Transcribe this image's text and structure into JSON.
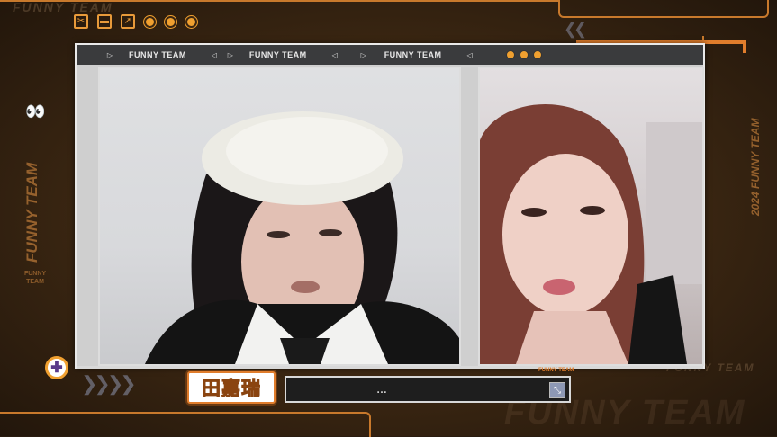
{
  "titlebar": {
    "labels": [
      "FUNNY TEAM",
      "FUNNY TEAM",
      "FUNNY TEAM"
    ]
  },
  "side_left": {
    "vertical_text": "FUNNY TEAM",
    "small_text": "FUNNY TEAM"
  },
  "side_right": {
    "vertical_text": "2024 FUNNY TEAM"
  },
  "watermark": {
    "bottom": "FUNNY TEAM",
    "top_left": "FUNNY TEAM",
    "right_small": "FUNNY TEAM"
  },
  "lower_third": {
    "name": "田嘉瑞",
    "caption": "…",
    "badge": "FUNNY TEAM"
  },
  "colors": {
    "accent": "#e07d2c",
    "dot": "#f0a030",
    "background": "#3a2612"
  },
  "icons": [
    "scissors-icon",
    "battery-icon",
    "rocket-icon",
    "eyes-icon",
    "add-icon",
    "expand-icon"
  ]
}
